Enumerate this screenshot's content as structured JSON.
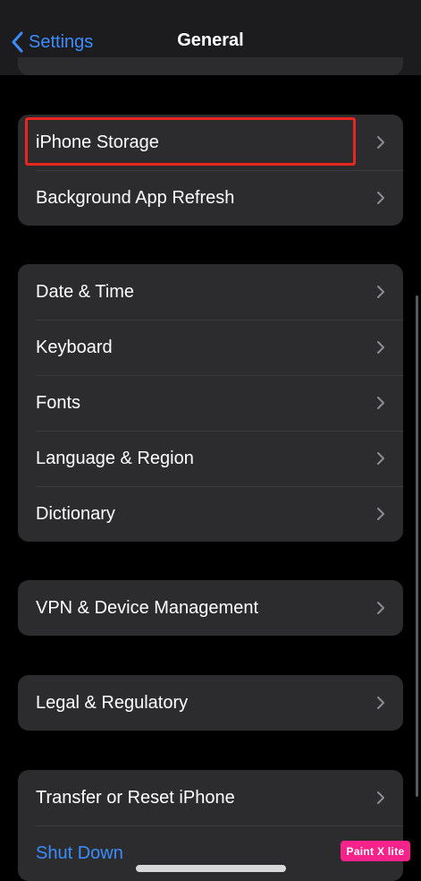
{
  "navbar": {
    "back_label": "Settings",
    "title": "General"
  },
  "groups": [
    {
      "items": [
        {
          "label": "iPhone Storage"
        },
        {
          "label": "Background App Refresh"
        }
      ]
    },
    {
      "items": [
        {
          "label": "Date & Time"
        },
        {
          "label": "Keyboard"
        },
        {
          "label": "Fonts"
        },
        {
          "label": "Language & Region"
        },
        {
          "label": "Dictionary"
        }
      ]
    },
    {
      "items": [
        {
          "label": "VPN & Device Management"
        }
      ]
    },
    {
      "items": [
        {
          "label": "Legal & Regulatory"
        }
      ]
    },
    {
      "items": [
        {
          "label": "Transfer or Reset iPhone"
        },
        {
          "label": "Shut Down"
        }
      ]
    }
  ],
  "watermark": {
    "text": "Paint X lite"
  },
  "colors": {
    "background": "#000000",
    "cell": "#2c2c2e",
    "accent_blue": "#3a8dff",
    "highlight_red": "#e6261f",
    "watermark_pink": "#f7238a"
  },
  "icons": {
    "back": "chevron-left-icon",
    "disclosure": "chevron-right-icon"
  }
}
